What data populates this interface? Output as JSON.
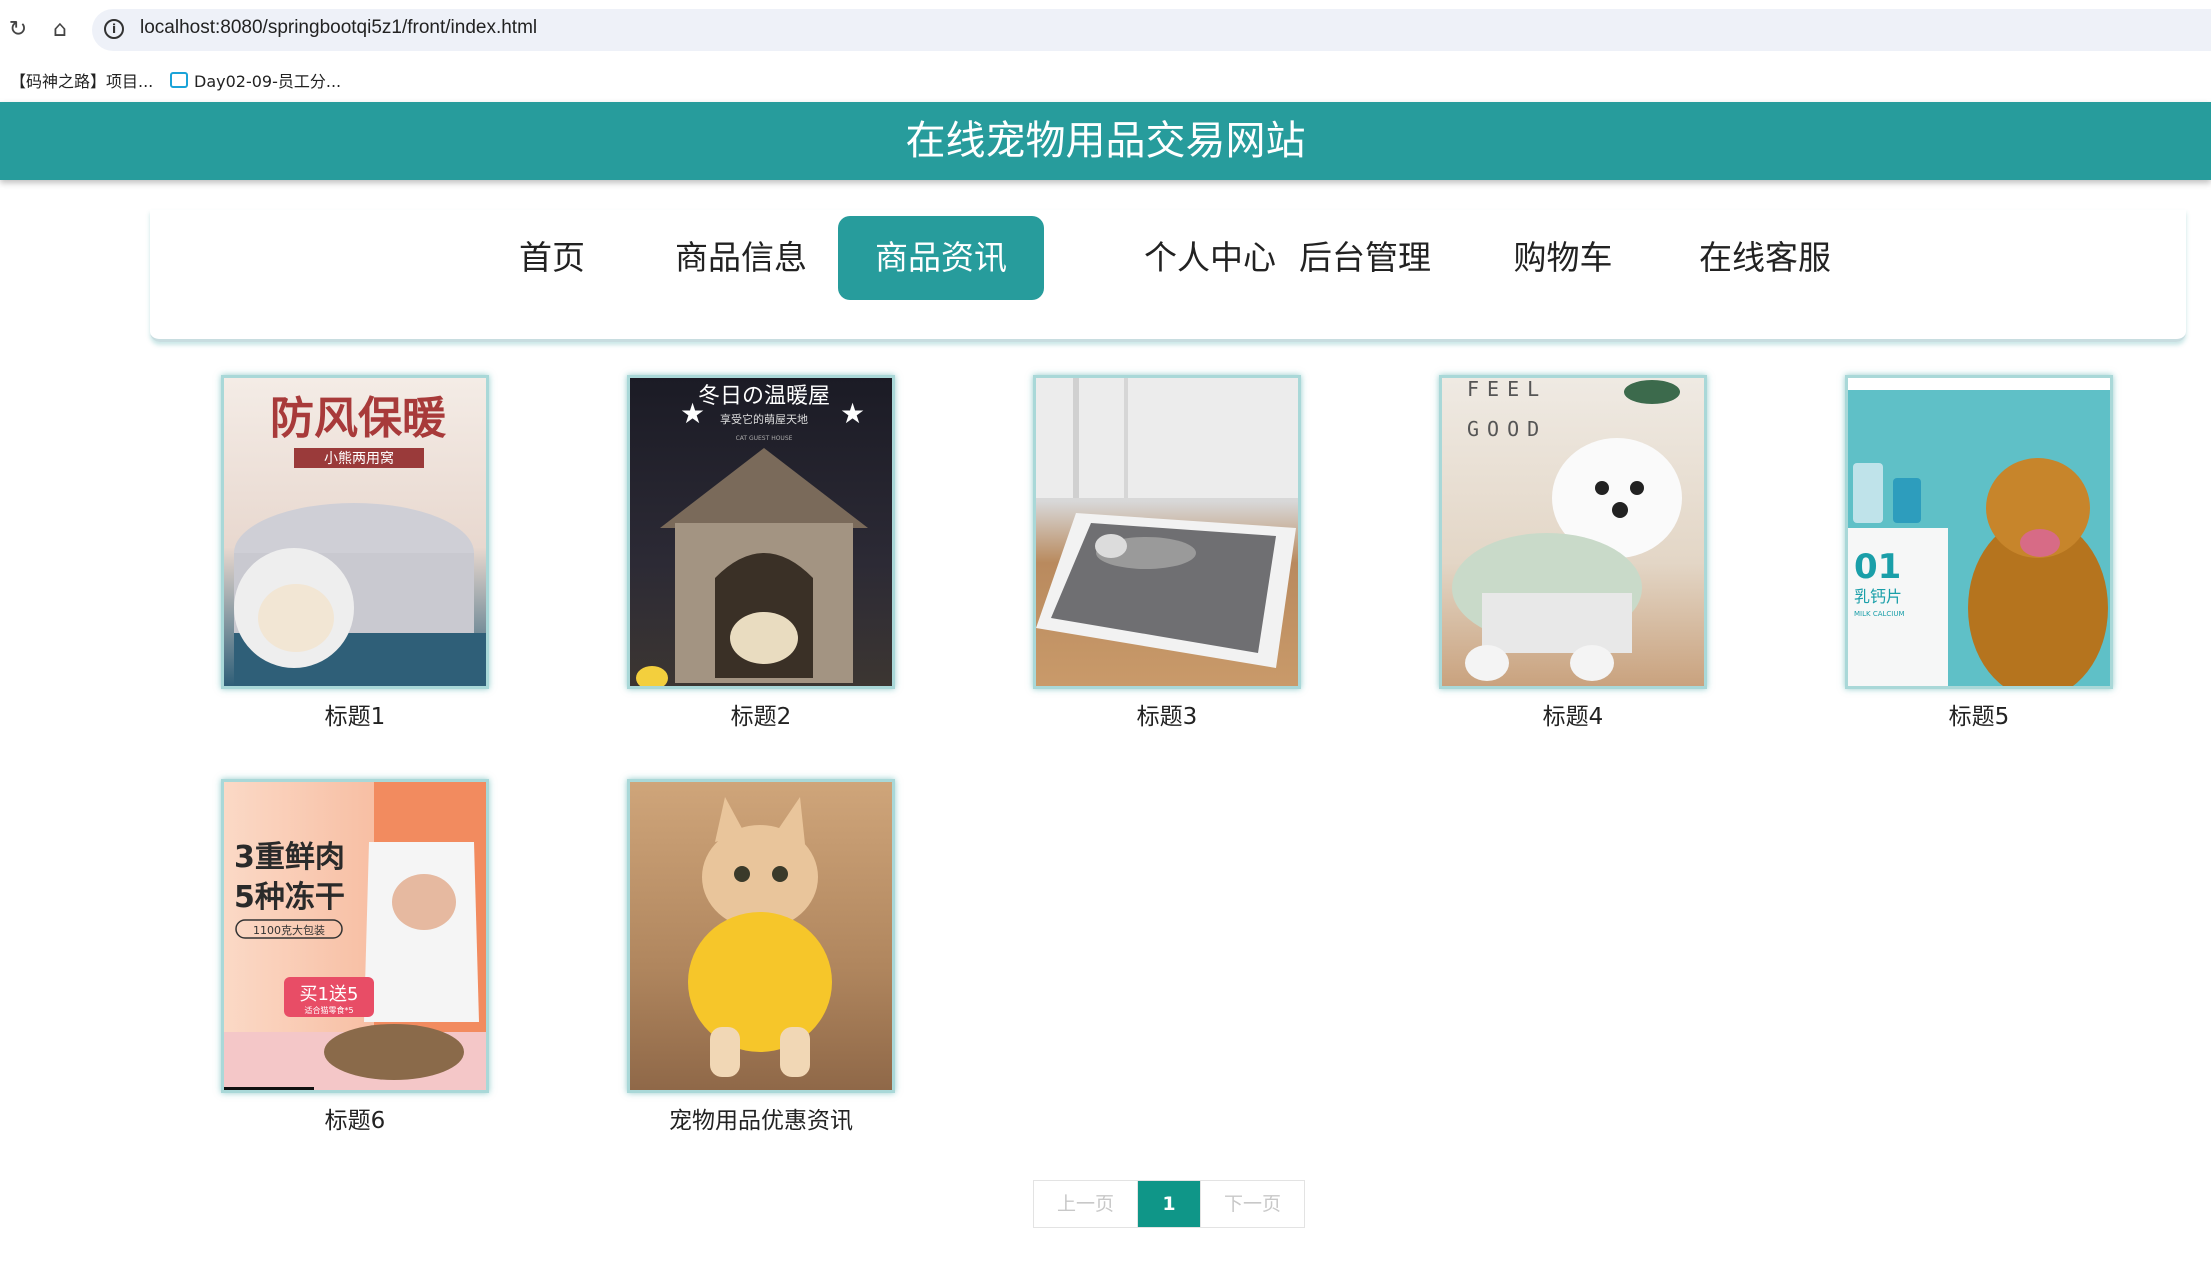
{
  "browser": {
    "url": "localhost:8080/springbootqi5z1/front/index.html",
    "bookmarks": [
      "【码神之路】项目...",
      "Day02-09-员工分..."
    ]
  },
  "site": {
    "title": "在线宠物用品交易网站"
  },
  "nav": {
    "items": [
      {
        "label": "首页"
      },
      {
        "label": "商品信息"
      },
      {
        "label": "商品资讯",
        "active": true
      },
      {
        "label": "个人中心"
      },
      {
        "label": "后台管理"
      },
      {
        "label": "购物车"
      },
      {
        "label": "在线客服"
      }
    ]
  },
  "news": [
    {
      "title": "标题1",
      "overlay": [
        "防风保暖",
        "小熊两用窝"
      ]
    },
    {
      "title": "标题2",
      "overlay": [
        "冬日の温暖屋",
        "享受它的萌屋天地",
        "CAT GUEST HOUSE"
      ]
    },
    {
      "title": "标题3",
      "overlay": []
    },
    {
      "title": "标题4",
      "overlay": [
        "FEEL",
        "GOOD"
      ]
    },
    {
      "title": "标题5",
      "overlay": [
        "01",
        "乳钙片",
        "MILK CALCIUM"
      ]
    },
    {
      "title": "标题6",
      "overlay": [
        "3重鲜肉",
        "5种冻干",
        "1100克大包装",
        "买1送5",
        "适合猫零食*5"
      ]
    },
    {
      "title": "宠物用品优惠资讯",
      "overlay": []
    }
  ],
  "pagination": {
    "prev": "上一页",
    "current": "1",
    "next": "下一页"
  },
  "colors": {
    "primary": "#279c9c",
    "pager_active": "#0f9688"
  }
}
